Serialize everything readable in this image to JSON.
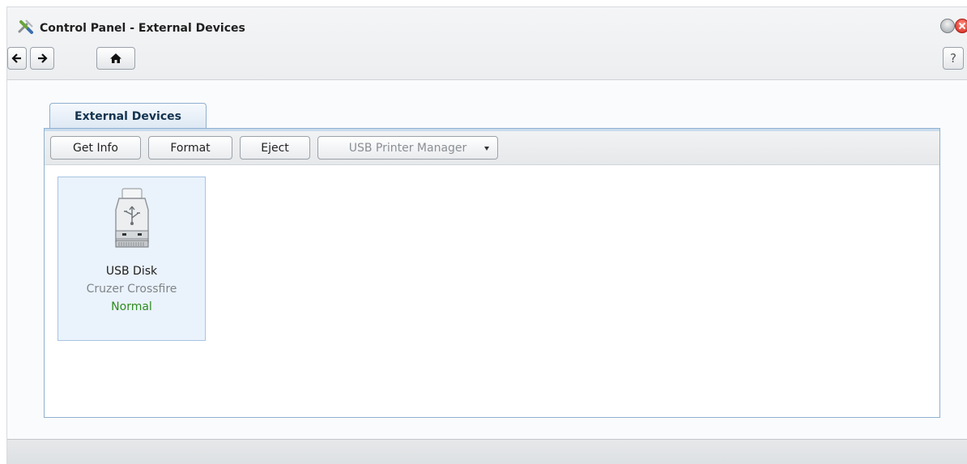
{
  "window": {
    "title": "Control Panel - External Devices",
    "title_icon": "tools-icon",
    "minimize_icon": "minimize-icon",
    "close_icon": "close-icon"
  },
  "navigation": {
    "back_icon": "arrow-left-icon",
    "forward_icon": "arrow-right-icon",
    "home_icon": "home-icon",
    "help_label": "?"
  },
  "tabs": [
    {
      "label": "External Devices",
      "active": true
    }
  ],
  "toolbar": {
    "get_info_label": "Get Info",
    "format_label": "Format",
    "eject_label": "Eject",
    "usb_printer_manager_label": "USB Printer Manager",
    "usb_printer_manager_enabled": false
  },
  "devices": [
    {
      "icon": "usb-drive-icon",
      "name": "USB Disk",
      "model": "Cruzer Crossfire",
      "status": "Normal",
      "selected": true
    }
  ],
  "colors": {
    "status_normal": "#2e8b1f",
    "panel_border": "#8fb0d1",
    "selection_bg": "#eaf2fb",
    "close_button": "#d3231b"
  }
}
